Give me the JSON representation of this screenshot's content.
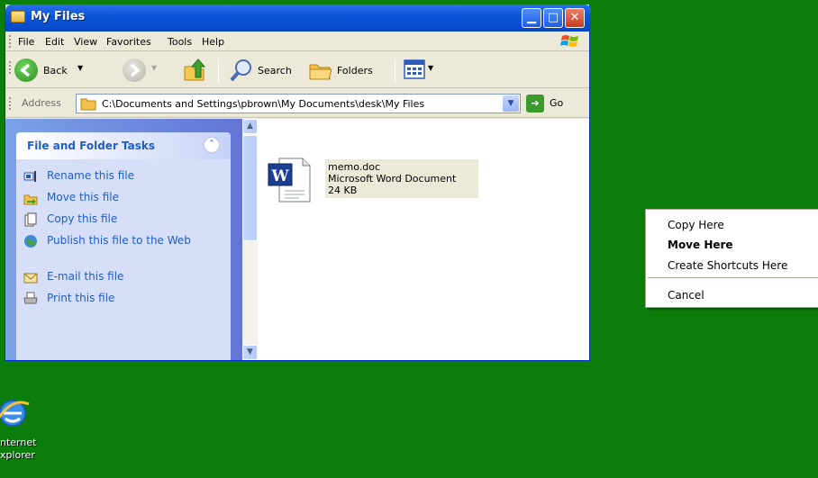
{
  "window": {
    "title": "My Files",
    "icon": "folder-icon",
    "controls": [
      "minimize-icon",
      "maximize-icon",
      "close-icon"
    ]
  },
  "menu": {
    "items": [
      "File",
      "Edit",
      "View",
      "Favorites",
      "Tools",
      "Help"
    ]
  },
  "toolbar": {
    "back_label": "Back",
    "search_label": "Search",
    "folders_label": "Folders"
  },
  "address": {
    "label": "Address",
    "value": "C:\\Documents and Settings\\pbrown\\My Documents\\desk\\My Files",
    "go_label": "Go"
  },
  "tasks": {
    "title": "File and Folder Tasks",
    "items": [
      {
        "label": "Rename this file",
        "icon": "rename-icon"
      },
      {
        "label": "Move this file",
        "icon": "move-icon"
      },
      {
        "label": "Copy this file",
        "icon": "copy-icon"
      },
      {
        "label": "Publish this file to the Web",
        "icon": "publish-web-icon"
      },
      {
        "label": "E-mail this file",
        "icon": "email-icon"
      },
      {
        "label": "Print this file",
        "icon": "print-icon"
      }
    ]
  },
  "file": {
    "name": "memo.doc",
    "type": "Microsoft Word Document",
    "size": "24 KB",
    "icon": "word-document-icon"
  },
  "context_menu": {
    "items": [
      "Copy Here",
      "Move Here",
      "Create Shortcuts Here",
      "Cancel"
    ],
    "default_item": "Move Here"
  },
  "desktop": {
    "icon_label_line1": "nternet",
    "icon_label_line2": "xplorer",
    "icon": "internet-explorer-icon"
  },
  "colors": {
    "desktop": "#0b7d0b",
    "titlebar": "#0a55d8",
    "task_link": "#215dc6"
  }
}
